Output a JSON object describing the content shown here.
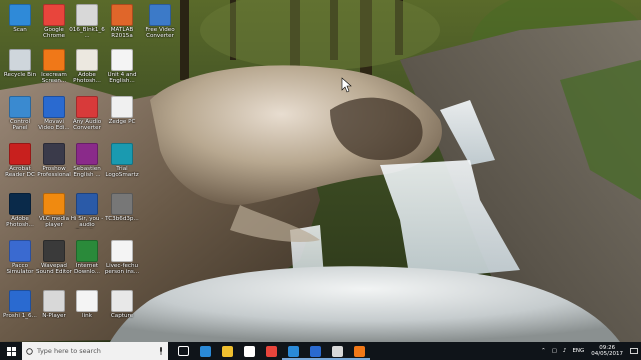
{
  "desktop": {
    "icons": [
      {
        "label": "Scan",
        "icon": "scan-folder-icon",
        "color": "#2f8ad8"
      },
      {
        "label": "Google Chrome",
        "icon": "chrome-icon",
        "color": "#e8453c"
      },
      {
        "label": "016_Blnk1_6...",
        "icon": "document-icon",
        "color": "#d8d8d8"
      },
      {
        "label": "MATLAB R2015a",
        "icon": "matlab-icon",
        "color": "#e0662a"
      },
      {
        "label": "Free Video Converter",
        "icon": "video-converter-icon",
        "color": "#3c7ac8"
      },
      {
        "label": "Recycle Bin",
        "icon": "recycle-bin-icon",
        "color": "#cfd6dc"
      },
      {
        "label": "Icecream Screen...",
        "icon": "icecream-icon",
        "color": "#f07818"
      },
      {
        "label": "Adobe Photosh...",
        "icon": "photoshop-disc-icon",
        "color": "#ece8e0"
      },
      {
        "label": "Unit 4 and English...",
        "icon": "pdf-icon",
        "color": "#f4f4f4"
      },
      {
        "label": "Control Panel",
        "icon": "control-panel-icon",
        "color": "#3a8ad0"
      },
      {
        "label": "Movavi Video Edi...",
        "icon": "movavi-icon",
        "color": "#2a6ad0"
      },
      {
        "label": "Any Audio Converter",
        "icon": "audio-converter-icon",
        "color": "#d83a3a"
      },
      {
        "label": "Zedge PC",
        "icon": "zedge-icon",
        "color": "#f0f0f0"
      },
      {
        "label": "Acrobat Reader DC",
        "icon": "acrobat-icon",
        "color": "#c8201e"
      },
      {
        "label": "Proshow Professional",
        "icon": "proshow-icon",
        "color": "#3a3a4a"
      },
      {
        "label": "Sebastien English ...",
        "icon": "winrar-icon",
        "color": "#8a2a8a"
      },
      {
        "label": "Trial LogoSmartz",
        "icon": "logo-icon",
        "color": "#1a9ab0"
      },
      {
        "label": "Adobe Photosh...",
        "icon": "photoshop-icon",
        "color": "#0a2a4a"
      },
      {
        "label": "VLC media player",
        "icon": "vlc-icon",
        "color": "#f08a10"
      },
      {
        "label": "Hi Sir, you - audio Equali...",
        "icon": "word-icon",
        "color": "#2a5aa8"
      },
      {
        "label": "TC3b6d3p...",
        "icon": "file-icon",
        "color": "#777777"
      },
      {
        "label": "Pacco Simulator",
        "icon": "simulator-icon",
        "color": "#3a6ad0"
      },
      {
        "label": "Wavepad Sound Editor",
        "icon": "wavepad-icon",
        "color": "#3a3a3a"
      },
      {
        "label": "Internet Downlo...",
        "icon": "idm-icon",
        "color": "#2a8a3a"
      },
      {
        "label": "Livec-fechu person ins...",
        "icon": "pdf-doc-icon",
        "color": "#f4f4f4"
      },
      {
        "label": "Proshi 1_6...",
        "icon": "app-icon",
        "color": "#2a6ad0"
      },
      {
        "label": "N-Player",
        "icon": "kmplayer-icon",
        "color": "#d8d8d8"
      },
      {
        "label": "link",
        "icon": "text-file-icon",
        "color": "#f4f4f4"
      },
      {
        "label": "Capture",
        "icon": "capture-icon",
        "color": "#e8e8e8"
      }
    ]
  },
  "taskbar": {
    "search_placeholder": "Type here to search",
    "apps": [
      {
        "name": "task-view",
        "color": "#ffffff"
      },
      {
        "name": "edge",
        "color": "#2a8ad8"
      },
      {
        "name": "file-explorer",
        "color": "#f0c030"
      },
      {
        "name": "store",
        "color": "#ffffff"
      },
      {
        "name": "chrome",
        "color": "#e8453c"
      },
      {
        "name": "photos",
        "color": "#2a8ad8"
      },
      {
        "name": "movavi",
        "color": "#2a6ad0"
      },
      {
        "name": "kmplayer",
        "color": "#d8d8d8"
      },
      {
        "name": "icecream",
        "color": "#f07818"
      }
    ],
    "tray": {
      "language": "ENG",
      "time": "09:26",
      "date": "04/05/2017"
    }
  }
}
